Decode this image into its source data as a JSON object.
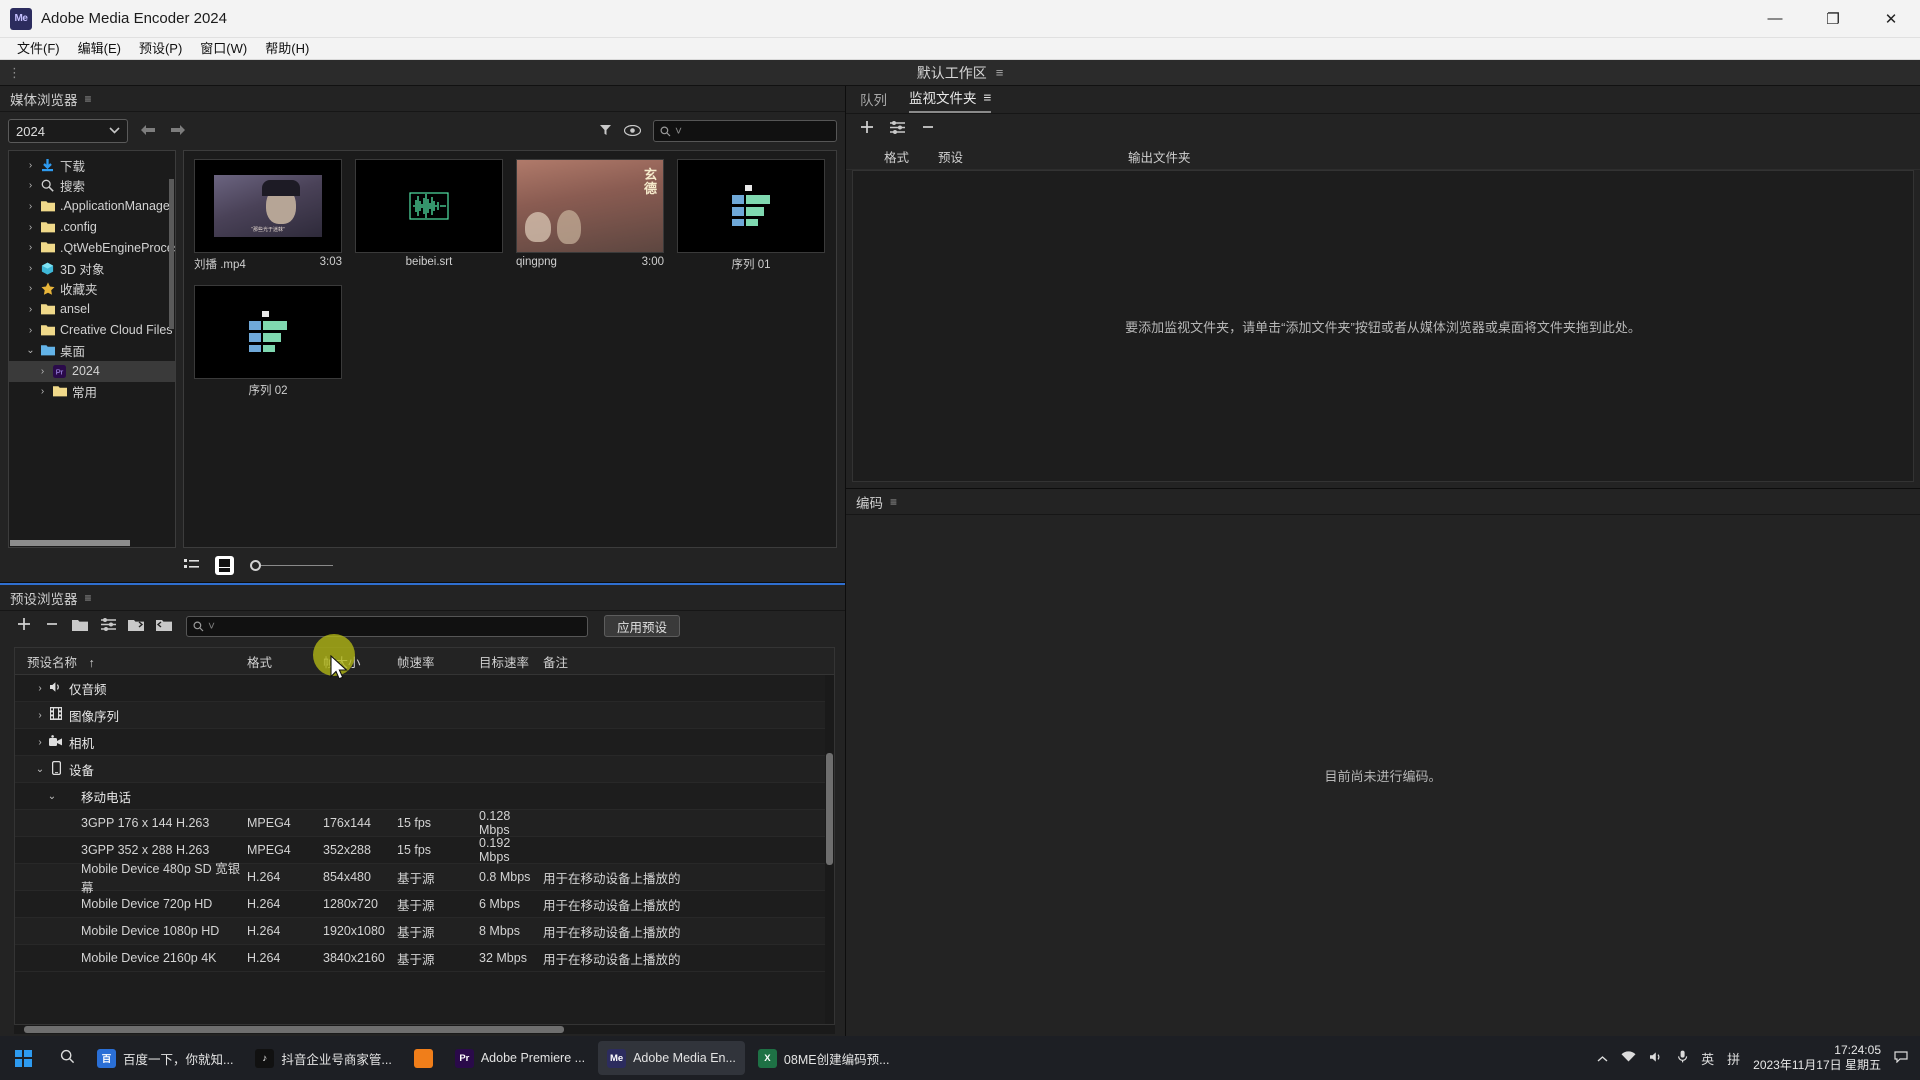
{
  "window": {
    "app_logo_text": "Me",
    "title": "Adobe Media Encoder 2024",
    "minimize": "—",
    "maximize": "❐",
    "close": "✕"
  },
  "menu": {
    "items": [
      "文件(F)",
      "编辑(E)",
      "预设(P)",
      "窗口(W)",
      "帮助(H)"
    ]
  },
  "workspace": {
    "left_handle": "⋮",
    "name": "默认工作区",
    "menu_icon": "≡"
  },
  "media_browser": {
    "title": "媒体浏览器",
    "menu_icon": "≡",
    "path_select": "2024",
    "chevron": "⌄",
    "back_arrow": "←",
    "forward_arrow": "→",
    "filter_icon": "filter-icon",
    "eye_icon": "eye-icon",
    "search_placeholder": "",
    "tree": [
      {
        "label": "下载",
        "icon": "download-icon",
        "indent": 0,
        "twisty": "›",
        "selected": false
      },
      {
        "label": "搜索",
        "icon": "search-icon",
        "indent": 0,
        "twisty": "›",
        "selected": false
      },
      {
        "label": ".ApplicationManager",
        "icon": "folder-icon",
        "indent": 0,
        "twisty": "›",
        "selected": false
      },
      {
        "label": ".config",
        "icon": "folder-icon",
        "indent": 0,
        "twisty": "›",
        "selected": false
      },
      {
        "label": ".QtWebEngineProcess",
        "icon": "folder-icon",
        "indent": 0,
        "twisty": "›",
        "selected": false
      },
      {
        "label": "3D 对象",
        "icon": "cube-icon",
        "indent": 0,
        "twisty": "›",
        "selected": false
      },
      {
        "label": "收藏夹",
        "icon": "star-icon",
        "indent": 0,
        "twisty": "›",
        "selected": false
      },
      {
        "label": "ansel",
        "icon": "folder-icon",
        "indent": 0,
        "twisty": "›",
        "selected": false
      },
      {
        "label": "Creative Cloud Files",
        "icon": "folder-icon",
        "indent": 0,
        "twisty": "›",
        "selected": false
      },
      {
        "label": "桌面",
        "icon": "desktop-folder-icon",
        "indent": 0,
        "twisty": "⌄",
        "selected": false
      },
      {
        "label": "2024",
        "icon": "premiere-icon",
        "indent": 1,
        "twisty": "›",
        "selected": true
      },
      {
        "label": "常用",
        "icon": "folder-icon",
        "indent": 1,
        "twisty": "›",
        "selected": false
      }
    ],
    "thumbnails": [
      {
        "name": "刘播 .mp4",
        "duration": "3:03",
        "kind": "video",
        "overlay": "“那些光于迷韎”"
      },
      {
        "name": "beibei.srt",
        "duration": "",
        "kind": "audio",
        "overlay": ""
      },
      {
        "name": "qingpng",
        "duration": "3:00",
        "kind": "image",
        "overlay": "玄德"
      },
      {
        "name": "序列 01",
        "duration": "",
        "kind": "sequence",
        "overlay": ""
      },
      {
        "name": "序列 02",
        "duration": "",
        "kind": "sequence",
        "overlay": ""
      }
    ],
    "footer": {
      "list_view_icon": "list-view-icon",
      "thumb_view_icon": "thumbnail-view-icon",
      "zoom_slider_value": "0"
    }
  },
  "preset_browser": {
    "title": "预设浏览器",
    "menu_icon": "≡",
    "toolbar": [
      {
        "name": "new-preset-icon",
        "glyph": "+"
      },
      {
        "name": "delete-preset-icon",
        "glyph": "−"
      },
      {
        "name": "new-folder-icon",
        "glyph": "▱"
      },
      {
        "name": "preset-settings-icon",
        "glyph": "☲"
      },
      {
        "name": "import-preset-icon",
        "glyph": "↵"
      },
      {
        "name": "export-preset-icon",
        "glyph": "↳"
      }
    ],
    "search_placeholder": "",
    "apply_button": "应用预设",
    "columns": [
      "预设名称",
      "格式",
      "帧大小",
      "帧速率",
      "目标速率",
      "备注"
    ],
    "sort_indicator": "↑",
    "rows": [
      {
        "type": "group",
        "level": 0,
        "twisty": "›",
        "icon": "speaker-icon",
        "name": "仅音频",
        "format": "",
        "size": "",
        "fps": "",
        "bitrate": "",
        "note": ""
      },
      {
        "type": "group",
        "level": 0,
        "twisty": "›",
        "icon": "film-icon",
        "name": "图像序列",
        "format": "",
        "size": "",
        "fps": "",
        "bitrate": "",
        "note": ""
      },
      {
        "type": "group",
        "level": 0,
        "twisty": "›",
        "icon": "camera-icon",
        "name": "相机",
        "format": "",
        "size": "",
        "fps": "",
        "bitrate": "",
        "note": ""
      },
      {
        "type": "group",
        "level": 0,
        "twisty": "⌄",
        "icon": "device-icon",
        "name": "设备",
        "format": "",
        "size": "",
        "fps": "",
        "bitrate": "",
        "note": ""
      },
      {
        "type": "group",
        "level": 1,
        "twisty": "⌄",
        "icon": "",
        "name": "移动电话",
        "format": "",
        "size": "",
        "fps": "",
        "bitrate": "",
        "note": ""
      },
      {
        "type": "item",
        "level": 2,
        "name": "3GPP 176 x 144 H.263",
        "format": "MPEG4",
        "size": "176x144",
        "fps": "15 fps",
        "bitrate": "0.128 Mbps",
        "note": ""
      },
      {
        "type": "item",
        "level": 2,
        "name": "3GPP 352 x 288 H.263",
        "format": "MPEG4",
        "size": "352x288",
        "fps": "15 fps",
        "bitrate": "0.192 Mbps",
        "note": ""
      },
      {
        "type": "item",
        "level": 2,
        "name": "Mobile Device 480p SD 宽银幕",
        "format": "H.264",
        "size": "854x480",
        "fps": "基于源",
        "bitrate": "0.8 Mbps",
        "note": "用于在移动设备上播放的"
      },
      {
        "type": "item",
        "level": 2,
        "name": "Mobile Device 720p HD",
        "format": "H.264",
        "size": "1280x720",
        "fps": "基于源",
        "bitrate": "6 Mbps",
        "note": "用于在移动设备上播放的"
      },
      {
        "type": "item",
        "level": 2,
        "name": "Mobile Device 1080p HD",
        "format": "H.264",
        "size": "1920x1080",
        "fps": "基于源",
        "bitrate": "8 Mbps",
        "note": "用于在移动设备上播放的"
      },
      {
        "type": "item",
        "level": 2,
        "name": "Mobile Device 2160p 4K",
        "format": "H.264",
        "size": "3840x2160",
        "fps": "基于源",
        "bitrate": "32 Mbps",
        "note": "用于在移动设备上播放的"
      }
    ]
  },
  "queue": {
    "tabs": [
      {
        "label": "队列",
        "active": false,
        "menu": ""
      },
      {
        "label": "监视文件夹",
        "active": true,
        "menu": "≡"
      }
    ],
    "toolbar": [
      {
        "name": "add-folder-icon",
        "glyph": "+"
      },
      {
        "name": "queue-settings-icon",
        "glyph": "☲"
      },
      {
        "name": "remove-folder-icon",
        "glyph": "−"
      }
    ],
    "columns": [
      "格式",
      "预设",
      "输出文件夹"
    ],
    "empty_message": "要添加监视文件夹，请单击“添加文件夹”按钮或者从媒体浏览器或桌面将文件夹拖到此处。"
  },
  "encoding": {
    "title": "编码",
    "menu_icon": "≡",
    "empty_message": "目前尚未进行编码。"
  },
  "taskbar": {
    "start_icon": "windows-start-icon",
    "search_icon": "⚲",
    "items": [
      {
        "label": "百度一下，你就知...",
        "icon_text": "百",
        "icon_color": "#2a6fd6",
        "active": false,
        "running": true
      },
      {
        "label": "抖音企业号商家管...",
        "icon_text": "♪",
        "icon_color": "#111111",
        "active": false,
        "running": true
      },
      {
        "label": "",
        "icon_text": "",
        "icon_color": "#f07e1a",
        "active": false,
        "running": true
      },
      {
        "label": "Adobe Premiere ...",
        "icon_text": "Pr",
        "icon_color": "#2a0a4a",
        "active": false,
        "running": true
      },
      {
        "label": "Adobe Media En...",
        "icon_text": "Me",
        "icon_color": "#2c2c5e",
        "active": true,
        "running": true
      },
      {
        "label": "08ME创建编码预...",
        "icon_text": "X",
        "icon_color": "#1e7145",
        "active": false,
        "running": true
      }
    ],
    "tray": [
      {
        "name": "chevron-up-icon",
        "glyph": "⌃"
      },
      {
        "name": "wifi-icon",
        "glyph": "◠"
      },
      {
        "name": "volume-icon",
        "glyph": "🔊"
      },
      {
        "name": "microphone-icon",
        "glyph": "🎙"
      },
      {
        "name": "ime-chinese-icon",
        "glyph": "英"
      },
      {
        "name": "ime-keyboard-icon",
        "glyph": "拼"
      }
    ],
    "clock_time": "17:24:05",
    "clock_date": "2023年11月17日 星期五",
    "notification_icon": "💬"
  }
}
